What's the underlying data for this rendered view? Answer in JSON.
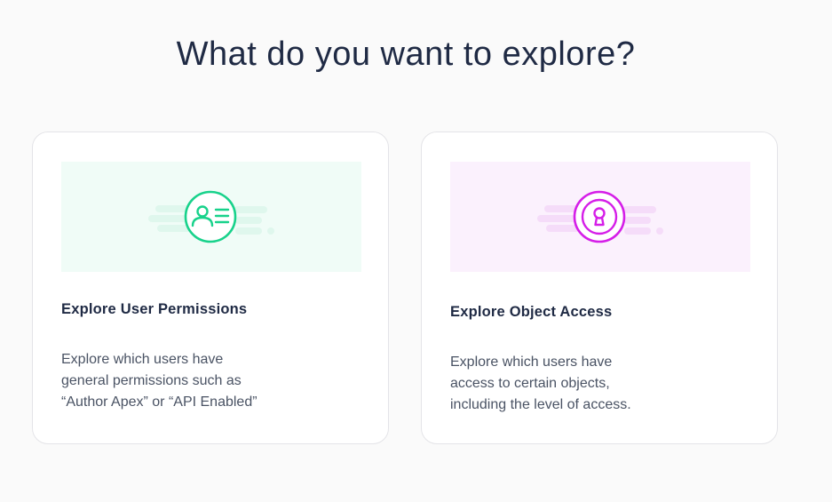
{
  "heading": "What do you want to explore?",
  "colors": {
    "green_accent": "#18d28b",
    "green_banner": "#f0fcf7",
    "purple_accent": "#d51ee8",
    "purple_banner": "#fbf1fd"
  },
  "cards": [
    {
      "icon": "user-id-card-icon",
      "title": "Explore User Permissions",
      "description_lines": [
        "Explore which users have",
        "general permissions such as",
        "“Author Apex” or “API Enabled”"
      ]
    },
    {
      "icon": "keyhole-lock-icon",
      "title": "Explore Object Access",
      "description_lines": [
        "Explore which users have",
        "access to certain objects,",
        "including the level of access."
      ]
    }
  ]
}
